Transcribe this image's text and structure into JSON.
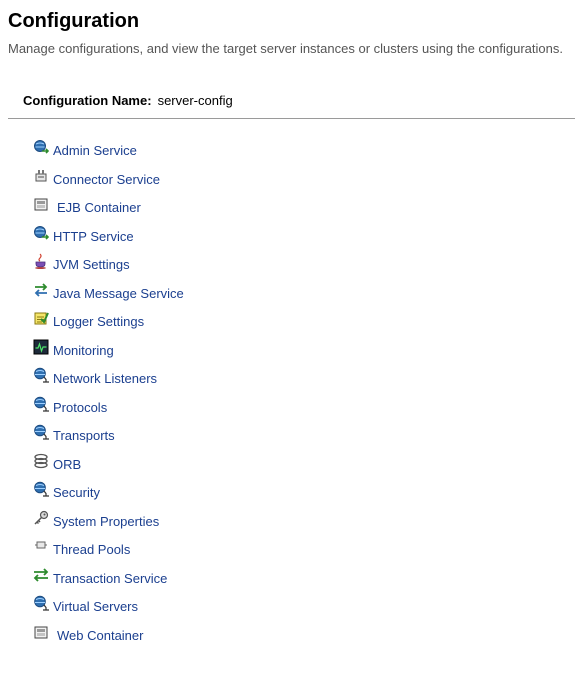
{
  "page": {
    "title": "Configuration",
    "help": "Manage configurations, and view the target server instances or clusters using the configurations."
  },
  "property": {
    "label": "Configuration Name:",
    "value": "server-config"
  },
  "links": [
    {
      "label": "Admin Service",
      "icon": "globe-arrow-icon"
    },
    {
      "label": "Connector Service",
      "icon": "connector-icon"
    },
    {
      "label": "EJB Container",
      "icon": "container-icon"
    },
    {
      "label": "HTTP Service",
      "icon": "globe-arrow-icon"
    },
    {
      "label": "JVM Settings",
      "icon": "java-cup-icon"
    },
    {
      "label": "Java Message Service",
      "icon": "message-arrows-icon"
    },
    {
      "label": "Logger Settings",
      "icon": "logger-icon"
    },
    {
      "label": "Monitoring",
      "icon": "monitor-icon"
    },
    {
      "label": "Network Listeners",
      "icon": "globe-stand-icon"
    },
    {
      "label": "Protocols",
      "icon": "globe-stand-icon"
    },
    {
      "label": "Transports",
      "icon": "globe-stand-icon"
    },
    {
      "label": "ORB",
      "icon": "orb-icon"
    },
    {
      "label": "Security",
      "icon": "globe-stand-icon"
    },
    {
      "label": "System Properties",
      "icon": "key-icon"
    },
    {
      "label": "Thread Pools",
      "icon": "thread-pool-icon"
    },
    {
      "label": "Transaction Service",
      "icon": "transaction-arrows-icon"
    },
    {
      "label": "Virtual Servers",
      "icon": "globe-stand-icon"
    },
    {
      "label": "Web Container",
      "icon": "container-icon"
    }
  ],
  "colors": {
    "link": "#1b3f8f",
    "help_text": "#555555",
    "divider": "#9a9a9a"
  }
}
